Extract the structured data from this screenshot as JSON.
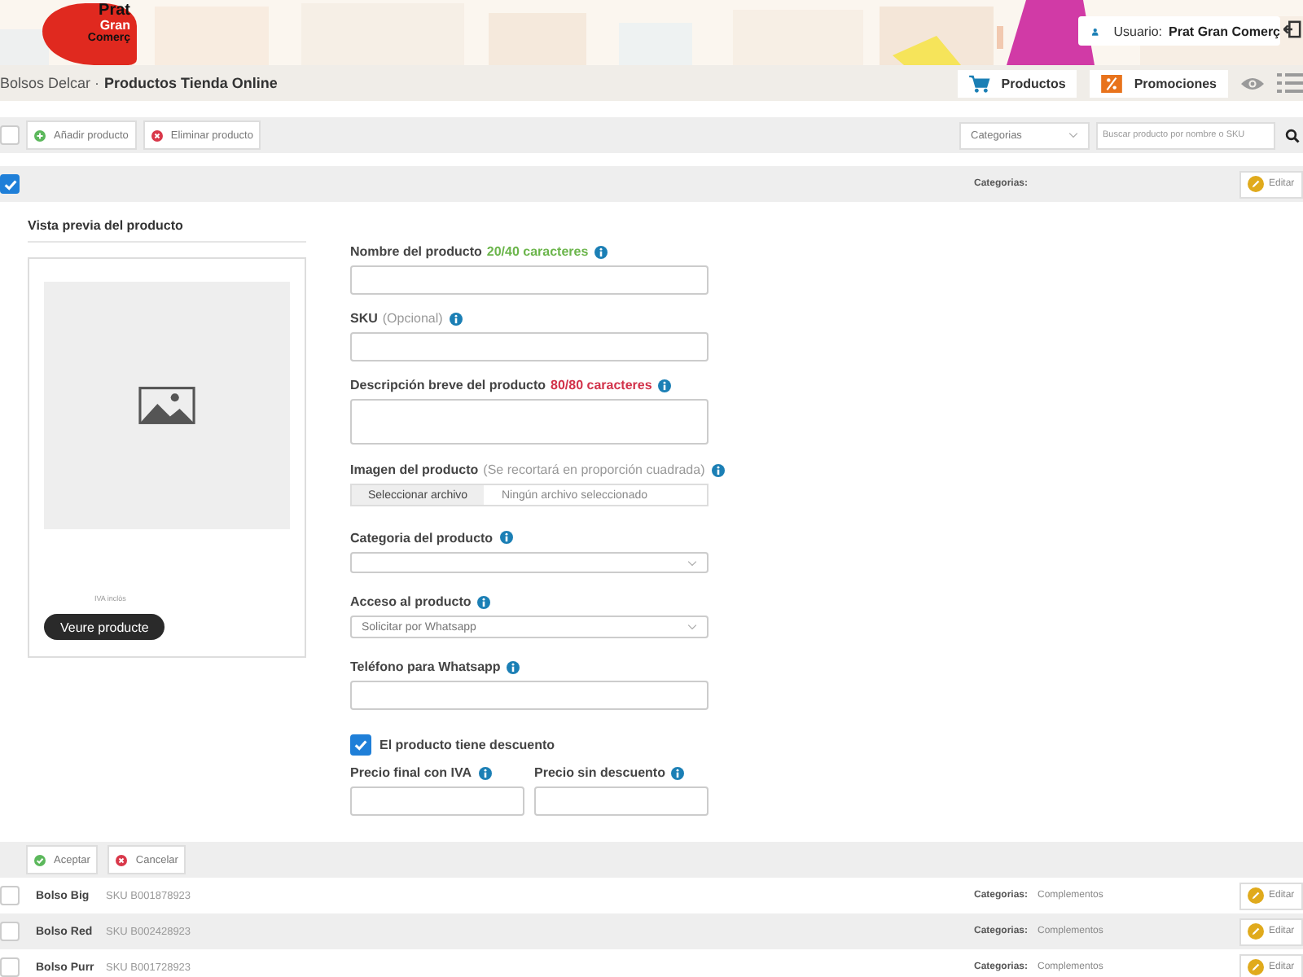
{
  "header": {
    "logo": [
      "Prat",
      "Gran",
      "Comerç"
    ],
    "user_label": "Usuario:",
    "user_name": "Prat Gran Comerç"
  },
  "breadcrumb": {
    "shop": "Bolsos Delcar ·",
    "page": "Productos Tienda Online"
  },
  "nav_buttons": [
    {
      "label": "Productos",
      "kind": "cart"
    },
    {
      "label": "Promociones",
      "kind": "percent"
    }
  ],
  "toolbar": {
    "select_all_checked": false,
    "buttons": [
      {
        "label": "Añadir producto",
        "kind": "add"
      },
      {
        "label": "Eliminar producto",
        "kind": "remove"
      }
    ],
    "category_filter": "Categorias",
    "search_placeholder": "Buscar producto por nombre o SKU"
  },
  "edit_row": {
    "checked": true,
    "categories_label": "Categorias:",
    "edit_button": "Editar"
  },
  "preview": {
    "title": "Vista previa del producto",
    "vat_note": "IVA inclòs",
    "button": "Veure producte"
  },
  "form": [
    {
      "kind": "text",
      "label": "Nombre del producto",
      "counter": "20/40 caracteres",
      "counter_full": false
    },
    {
      "kind": "text",
      "label": "SKU",
      "hint": "(Opcional)"
    },
    {
      "kind": "textarea",
      "label": "Descripción breve del producto",
      "counter": "80/80 caracteres",
      "counter_full": true
    },
    {
      "kind": "file",
      "label": "Imagen del producto",
      "hint": "(Se recortará en proporción cuadrada)",
      "button": "Seleccionar archivo",
      "value": "Ningún archivo seleccionado"
    },
    {
      "kind": "select",
      "label": "Categoria del producto"
    },
    {
      "kind": "select",
      "label": "Acceso al producto",
      "value": "Solicitar por Whatsapp"
    },
    {
      "kind": "text",
      "label": "Teléfono para Whatsapp"
    },
    {
      "kind": "checkbox",
      "label": "El producto tiene descuento",
      "checked": true
    },
    {
      "kind": "pair",
      "fields": [
        {
          "label": "Precio final con IVA"
        },
        {
          "label": "Precio sin descuento"
        }
      ]
    }
  ],
  "form_actions": [
    {
      "label": "Aceptar",
      "kind": "accept"
    },
    {
      "label": "Cancelar",
      "kind": "cancel"
    }
  ],
  "products": [
    {
      "name": "Bolso Big",
      "sku": "SKU B001878923",
      "categories_label": "Categorias:",
      "categories": "Complementos",
      "edit": "Editar",
      "checked": false
    },
    {
      "name": "Bolso Red",
      "sku": "SKU B002428923",
      "categories_label": "Categorias:",
      "categories": "Complementos",
      "edit": "Editar",
      "checked": false
    },
    {
      "name": "Bolso Purr",
      "sku": "SKU B001728923",
      "categories_label": "Categorias:",
      "categories": "Complementos",
      "edit": "Editar",
      "checked": false
    }
  ]
}
